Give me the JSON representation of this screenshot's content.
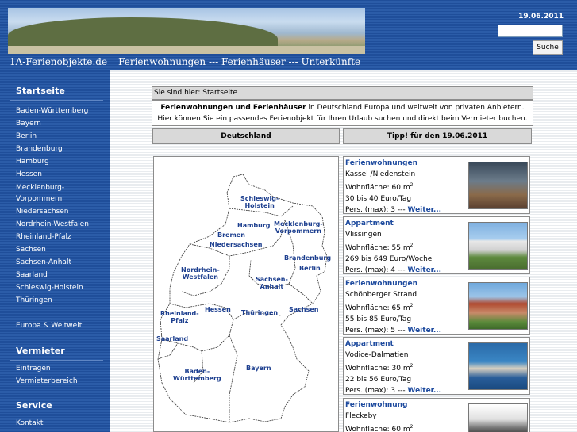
{
  "header": {
    "site_name": "1A-Ferienobjekte.de",
    "tagline": "Ferienwohnungen --- Ferienhäuser --- Unterkünfte",
    "date": "19.06.2011",
    "search_button": "Suche"
  },
  "sidebar": {
    "sections": [
      {
        "title": "Startseite"
      },
      {
        "title": "Vermieter"
      },
      {
        "title": "Service"
      }
    ],
    "states": [
      "Baden-Württemberg",
      "Bayern",
      "Berlin",
      "Brandenburg",
      "Hamburg",
      "Hessen",
      "Mecklenburg-",
      "Vorpommern",
      "Niedersachsen",
      "Nordrhein-Westfalen",
      "Rheinland-Pfalz",
      "Sachsen",
      "Sachsen-Anhalt",
      "Saarland",
      "Schleswig-Holstein",
      "Thüringen"
    ],
    "world": "Europa & Weltweit",
    "landlord_links": [
      "Eintragen",
      "Vermieterbereich"
    ],
    "service_links": [
      "Kontakt"
    ]
  },
  "main": {
    "breadcrumb": "Sie sind hier: Startseite",
    "intro_bold": "Ferienwohnungen und Ferienhäuser",
    "intro_rest": " in Deutschland Europa und weltweit von privaten Anbietern. Hier können Sie ein passendes Ferienobjekt für Ihren Urlaub suchen und direkt beim Vermieter buchen.",
    "col_germany": "Deutschland",
    "col_tip": "Tipp! für den 19.06.2011"
  },
  "map_labels": [
    "Schleswig-",
    "Holstein",
    "Hamburg",
    "Mecklenburg-",
    "Vorpommern",
    "Bremen",
    "Niedersachsen",
    "Brandenburg",
    "Berlin",
    "Nordrhein-",
    "Westfalen",
    "Sachsen-",
    "Anhalt",
    "Hessen",
    "Thüringen",
    "Sachsen",
    "Rheinland-",
    "Pfalz",
    "Saarland",
    "Baden-",
    "Württemberg",
    "Bayern"
  ],
  "offers": [
    {
      "type": "Ferienwohnungen",
      "place": "Kassel /Niedenstein",
      "area": "Wohnfläche: 60 m",
      "price": "30 bis 40 Euro/Tag",
      "persons": "Pers. (max): 3 --- ",
      "more": "Weiter..."
    },
    {
      "type": "Appartment",
      "place": "Vlissingen",
      "area": "Wohnfläche: 55 m",
      "price": "269 bis 649 Euro/Woche",
      "persons": "Pers. (max): 4 --- ",
      "more": "Weiter..."
    },
    {
      "type": "Ferienwohnungen",
      "place": "Schönberger Strand",
      "area": "Wohnfläche: 65 m",
      "price": "55 bis 85 Euro/Tag",
      "persons": "Pers. (max): 5 --- ",
      "more": "Weiter..."
    },
    {
      "type": "Appartment",
      "place": "Vodice-Dalmatien",
      "area": "Wohnfläche: 30 m",
      "price": "22 bis 56 Euro/Tag",
      "persons": "Pers. (max): 3 --- ",
      "more": "Weiter..."
    },
    {
      "type": "Ferienwohnung",
      "place": "Fleckeby",
      "area": "Wohnfläche: 60 m",
      "price": "",
      "persons": "",
      "more": ""
    }
  ],
  "area_unit_sup": "2",
  "colors": {
    "header_blue": "#2b5ca8",
    "link_blue": "#1d4a9e",
    "panel_gray": "#d9d9d9"
  }
}
